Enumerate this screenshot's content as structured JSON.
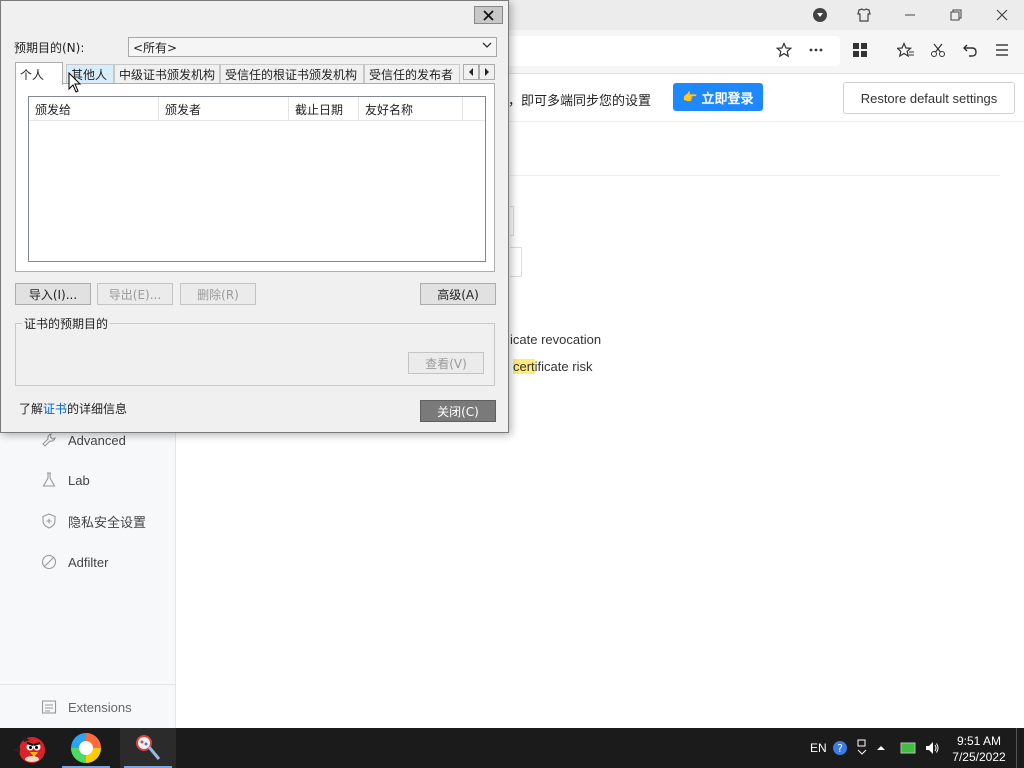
{
  "browser": {
    "window_controls": [
      "minimize",
      "restore",
      "close"
    ],
    "toolbar_icons": [
      "star-icon",
      "more-icon",
      "grid-icon",
      "favorites-icon",
      "scissors-icon",
      "undo-icon",
      "menu-icon"
    ]
  },
  "settings": {
    "sync_text": "，即可多端同步您的设置",
    "login_button": "立即登录",
    "restore_button": "Restore default settings",
    "option_revocation": "icate revocation",
    "option_risk_prefix": "cert",
    "option_risk_suffix": "ificate risk",
    "sidebar": [
      {
        "label": "Advanced",
        "icon": "wrench-icon"
      },
      {
        "label": "Lab",
        "icon": "flask-icon"
      },
      {
        "label": "隐私安全设置",
        "icon": "shield-icon"
      },
      {
        "label": "Adfilter",
        "icon": "block-icon"
      }
    ],
    "extensions_label": "Extensions"
  },
  "dialog": {
    "purpose_label": "预期目的(N):",
    "purpose_value": "<所有>",
    "tabs": [
      "个人",
      "其他人",
      "中级证书颁发机构",
      "受信任的根证书颁发机构",
      "受信任的发布者"
    ],
    "active_tab": "个人",
    "columns": [
      "颁发给",
      "颁发者",
      "截止日期",
      "友好名称"
    ],
    "buttons": {
      "import": "导入(I)...",
      "export": "导出(E)...",
      "remove": "删除(R)",
      "advanced": "高级(A)",
      "view": "查看(V)",
      "close": "关闭(C)"
    },
    "group_title": "证书的预期目的",
    "learn_prefix": "了解",
    "learn_link": "证书",
    "learn_suffix": "的详细信息"
  },
  "taskbar": {
    "language": "EN",
    "time": "9:51 AM",
    "date": "7/25/2022"
  }
}
